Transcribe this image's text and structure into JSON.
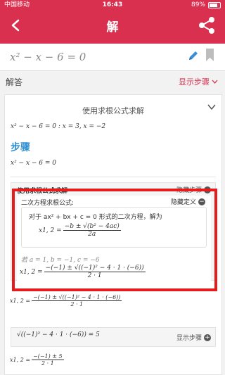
{
  "status_bar": {
    "carrier": "中国移动",
    "time": "16:43",
    "battery": "89%",
    "battery_level": 0.89
  },
  "app_bar": {
    "title": "解"
  },
  "equation": {
    "text": "x² − x − 6 = 0"
  },
  "answer_section": {
    "label": "解答",
    "show_steps": "显示步骤"
  },
  "card": {
    "method": "使用求根公式求解",
    "summary": "x² − x − 6 = 0   :   x = 3, x = −2",
    "steps_title": "步骤",
    "step_equation": "x² − x − 6 = 0",
    "subsection": {
      "title": "使用求根公式求解",
      "hide_steps": "隐藏步骤"
    },
    "definition": {
      "title": "二次方程求根公式:",
      "hide_definition": "隐藏定义",
      "intro": "对于 ax² + bx + c = 0 形式的二次方程，解为",
      "lhs": "x1, 2 =",
      "numerator": "−b ± √(b² − 4ac)",
      "denominator": "2a",
      "if_line": "若  a = 1, b = −1, c = −6",
      "subst_lhs": "x1, 2 =",
      "subst_numerator": "−(−1) ± √((−1)² − 4 · 1 · (−6))",
      "subst_denominator": "2 · 1"
    },
    "repeat_formula": {
      "lhs": "x1, 2 =",
      "numerator": "−(−1) ± √((−1)² − 4 · 1 · (−6))",
      "denominator": "2 · 1"
    },
    "sqrt_step": {
      "expr": "√((−1)² − 4 · 1 · (−6)) = 5",
      "show_steps": "显示步骤"
    },
    "final": {
      "lhs": "x1, 2 =",
      "numerator": "−(−1) ± 5",
      "denominator": "2 · 1"
    }
  }
}
